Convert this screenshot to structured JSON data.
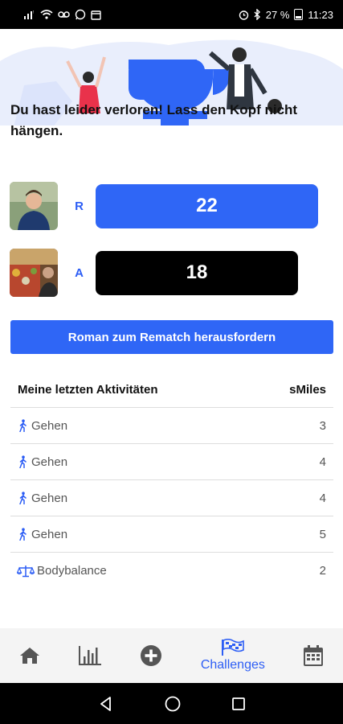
{
  "status_bar": {
    "battery": "27 %",
    "time": "11:23"
  },
  "hero": {
    "message": "Du hast leider verloren! Lass den Kopf nicht hängen."
  },
  "players": [
    {
      "initial": "R",
      "score": "22",
      "bar_color": "#2f66f6"
    },
    {
      "initial": "A",
      "score": "18",
      "bar_color": "#000000"
    }
  ],
  "rematch_button": {
    "label": "Roman zum Rematch herausfordern"
  },
  "activities": {
    "header_title": "Meine letzten Aktivitäten",
    "header_unit": "sMiles",
    "rows": [
      {
        "name": "Gehen",
        "value": "3",
        "icon": "walking-icon"
      },
      {
        "name": "Gehen",
        "value": "4",
        "icon": "walking-icon"
      },
      {
        "name": "Gehen",
        "value": "4",
        "icon": "walking-icon"
      },
      {
        "name": "Gehen",
        "value": "5",
        "icon": "walking-icon"
      },
      {
        "name": "Bodybalance",
        "value": "2",
        "icon": "balance-scale-icon"
      }
    ]
  },
  "bottom_nav": {
    "items": [
      {
        "icon": "home-icon"
      },
      {
        "icon": "bar-chart-icon"
      },
      {
        "icon": "plus-circle-icon"
      },
      {
        "icon": "flag-icon",
        "label": "Challenges",
        "active": true
      },
      {
        "icon": "calendar-icon"
      }
    ]
  },
  "colors": {
    "accent": "#2f66f6",
    "text": "#222222",
    "muted": "#555555"
  }
}
